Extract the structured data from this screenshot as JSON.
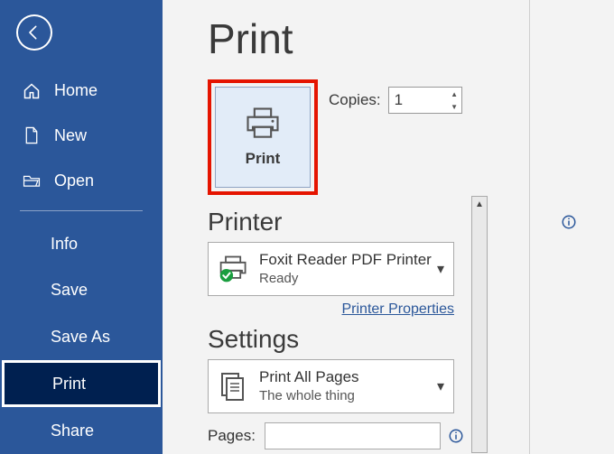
{
  "title": "Print",
  "sidebar": {
    "home": "Home",
    "new": "New",
    "open": "Open",
    "info": "Info",
    "save": "Save",
    "save_as": "Save As",
    "print": "Print",
    "share": "Share"
  },
  "print_button": {
    "label": "Print"
  },
  "copies": {
    "label": "Copies:",
    "value": "1"
  },
  "printer": {
    "heading": "Printer",
    "selected_name": "Foxit Reader PDF Printer",
    "selected_status": "Ready",
    "properties_link": "Printer Properties"
  },
  "settings": {
    "heading": "Settings",
    "scope_title": "Print All Pages",
    "scope_sub": "The whole thing",
    "pages_label": "Pages:",
    "pages_value": ""
  }
}
